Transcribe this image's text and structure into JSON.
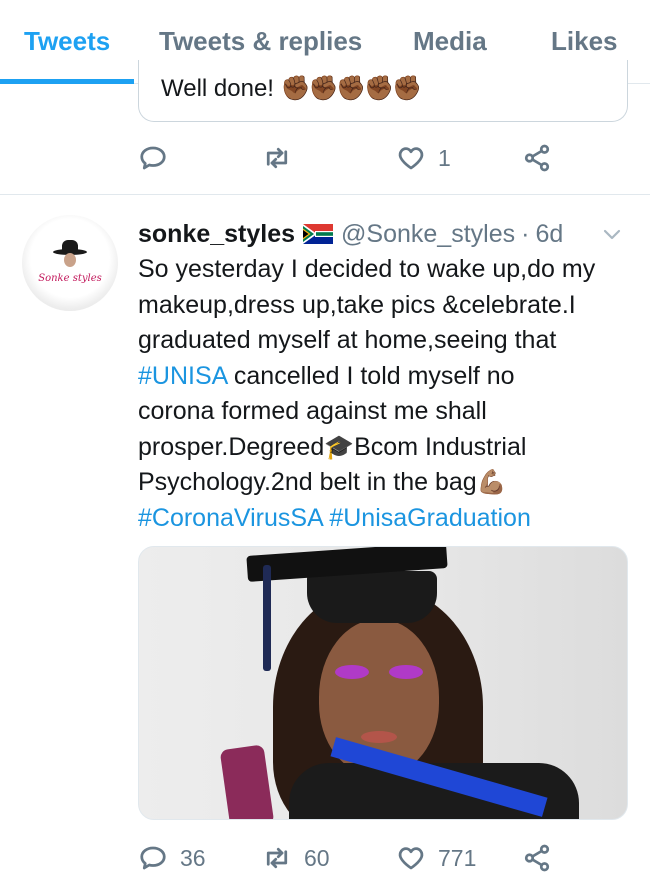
{
  "tabs": [
    {
      "label": "Tweets",
      "active": true
    },
    {
      "label": "Tweets & replies",
      "active": false
    },
    {
      "label": "Media",
      "active": false
    },
    {
      "label": "Likes",
      "active": false
    }
  ],
  "previous_tweet": {
    "quote_text": "Well done!",
    "quote_emoji": "✊🏾✊🏾✊🏾✊🏾✊🏾",
    "actions": {
      "reply_count": "",
      "retweet_count": "",
      "like_count": "1"
    }
  },
  "tweet": {
    "avatar_text": "Sonke styles",
    "display_name": "sonke_styles",
    "flag": "south-africa-flag",
    "handle": "@Sonke_styles",
    "separator": "·",
    "time": "6d",
    "body": {
      "line1": "So yesterday I decided to wake up,do my",
      "line2": "makeup,dress up,take pics &celebrate.I",
      "line3": "graduated myself at home,seeing that",
      "line4_hashtag": "#UNISA",
      "line4_rest": " cancelled I told myself no",
      "line5": "corona formed against me shall",
      "line6_a": "prosper.Degreed",
      "line6_emoji": "🎓",
      "line6_b": "Bcom Industrial",
      "line7_a": "Psychology.2nd belt in the bag",
      "line7_emoji": "💪🏽",
      "hashtag1": "#CoronaVirusSA",
      "hashtag2": "#UnisaGraduation"
    },
    "actions": {
      "reply_count": "36",
      "retweet_count": "60",
      "like_count": "771"
    }
  },
  "colors": {
    "accent": "#1da1f2",
    "hashtag": "#1b95e0",
    "secondary_text": "#657786",
    "divider": "#e1e8ed"
  }
}
